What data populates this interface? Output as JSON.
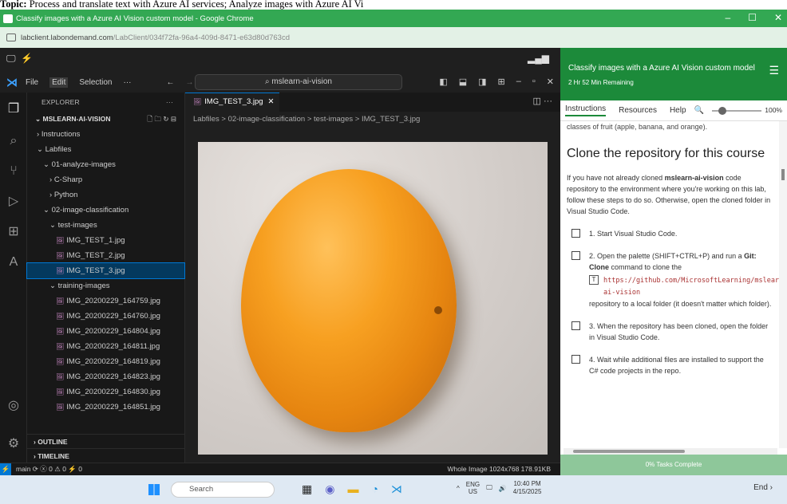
{
  "topic_line": {
    "prefix": "Topic:",
    "text": " Process and translate text with Azure AI services; Analyze images with Azure AI Vi"
  },
  "browser": {
    "window_title": "Classify images with a Azure AI Vision custom model - Google Chrome",
    "url_host": "labclient.labondemand.com",
    "url_path": "/LabClient/034f72fa-96a4-409d-8471-e63d80d763cd",
    "controls": [
      "–",
      "☐",
      "✕"
    ]
  },
  "vscode": {
    "menu": [
      "File",
      "Edit",
      "Selection",
      "···"
    ],
    "search_text": "mslearn-ai-vision",
    "explorer_header": "EXPLORER",
    "root_folder": "MSLEARN-AI-VISION",
    "tree": [
      {
        "label": "Instructions",
        "prefix": "›",
        "indent": 1
      },
      {
        "label": "Labfiles",
        "prefix": "⌄",
        "indent": 1
      },
      {
        "label": "01-analyze-images",
        "prefix": "⌄",
        "indent": 2
      },
      {
        "label": "C-Sharp",
        "prefix": "›",
        "indent": 3
      },
      {
        "label": "Python",
        "prefix": "›",
        "indent": 3
      },
      {
        "label": "02-image-classification",
        "prefix": "⌄",
        "indent": 2
      },
      {
        "label": "test-images",
        "prefix": "⌄",
        "indent": 3
      },
      {
        "label": "IMG_TEST_1.jpg",
        "image": true,
        "indent": 4
      },
      {
        "label": "IMG_TEST_2.jpg",
        "image": true,
        "indent": 4
      },
      {
        "label": "IMG_TEST_3.jpg",
        "image": true,
        "indent": 4,
        "selected": true
      },
      {
        "label": "training-images",
        "prefix": "⌄",
        "indent": 3
      },
      {
        "label": "IMG_20200229_164759.jpg",
        "image": true,
        "indent": 4
      },
      {
        "label": "IMG_20200229_164760.jpg",
        "image": true,
        "indent": 4
      },
      {
        "label": "IMG_20200229_164804.jpg",
        "image": true,
        "indent": 4
      },
      {
        "label": "IMG_20200229_164811.jpg",
        "image": true,
        "indent": 4
      },
      {
        "label": "IMG_20200229_164819.jpg",
        "image": true,
        "indent": 4
      },
      {
        "label": "IMG_20200229_164823.jpg",
        "image": true,
        "indent": 4
      },
      {
        "label": "IMG_20200229_164830.jpg",
        "image": true,
        "indent": 4
      },
      {
        "label": "IMG_20200229_164851.jpg",
        "image": true,
        "indent": 4
      }
    ],
    "outline_label": "OUTLINE",
    "timeline_label": "TIMELINE",
    "tab_label": "IMG_TEST_3.jpg",
    "breadcrumb": "Labfiles > 02-image-classification > test-images > IMG_TEST_3.jpg",
    "status_left": "main ⟳  ⓧ 0 ⚠ 0   ⚡ 0",
    "status_right": "Whole Image    1024x768    178.91KB"
  },
  "panel": {
    "title": "Classify images with a Azure AI Vision custom model",
    "time_remaining": "2 Hr 52 Min Remaining",
    "tabs": [
      "Instructions",
      "Resources",
      "Help"
    ],
    "zoom": "100%",
    "cut_text": "classes of fruit (apple, banana, and orange).",
    "heading": "Clone the repository for this course",
    "intro_a": "If you have not already cloned ",
    "intro_bold": "mslearn-ai-vision",
    "intro_b": " code repository to the environment where you're working on this lab, follow these steps to do so. Otherwise, open the cloned folder in Visual Studio Code.",
    "step1": "1. Start Visual Studio Code.",
    "step2_a": "2. Open the palette (SHIFT+CTRL+P) and run a ",
    "step2_bold1": "Git: Clone",
    "step2_b": " command to clone the",
    "step2_code": "https://github.com/MicrosoftLearning/mslearn-ai-vision",
    "step2_c": "repository to a local folder (it doesn't matter which folder).",
    "step3": "3. When the repository has been cloned, open the folder in Visual Studio Code.",
    "step4": "4. Wait while additional files are installed to support the C# code projects in the repo.",
    "progress_label": "0% Tasks Complete"
  },
  "taskbar": {
    "search_placeholder": "Search",
    "lang_top": "ENG",
    "lang_bottom": "US",
    "time": "10:40 PM",
    "date": "4/15/2025",
    "end_label": "End ›"
  }
}
